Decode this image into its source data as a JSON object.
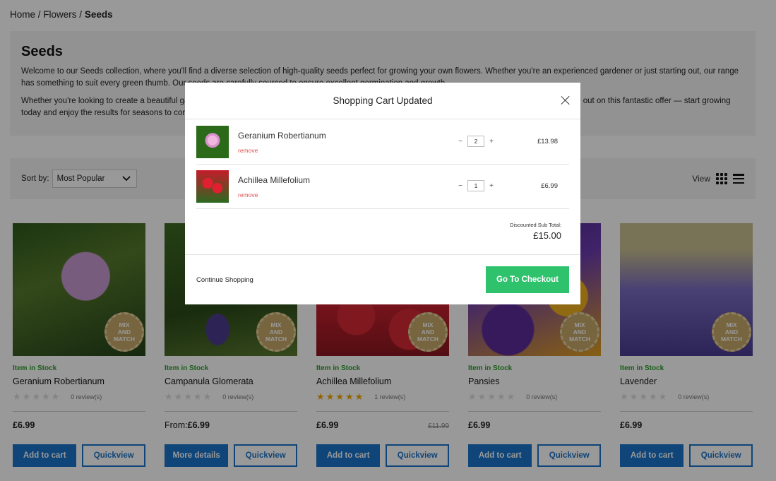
{
  "breadcrumb": {
    "home": "Home",
    "sep": " / ",
    "flowers": "Flowers",
    "current": "Seeds"
  },
  "intro": {
    "title": "Seeds",
    "p1": "Welcome to our Seeds collection, where you'll find a diverse selection of high-quality seeds perfect for growing your own flowers. Whether you're an experienced gardener or just starting out, our range has something to suit every green thumb. Our seeds are carefully sourced to ensure excellent germination and growth.",
    "p2": "Whether you're looking to create a beautiful garden display or fill your borders with vibrant blooms, our seeds collection has everything you need. Don't miss out on this fantastic offer — start growing today and enjoy the results for seasons to come."
  },
  "toolbar": {
    "sort_label": "Sort by:",
    "sort_value": "Most Popular",
    "view_label": "View"
  },
  "products": [
    {
      "name": "Geranium Robertianum",
      "stock": "Item in Stock",
      "reviews": "0 review(s)",
      "price": "£6.99",
      "price_prefix": "",
      "was": "",
      "rating": 0,
      "primary": "Add to cart",
      "secondary": "Quickview"
    },
    {
      "name": "Campanula Glomerata",
      "stock": "Item in Stock",
      "reviews": "0 review(s)",
      "price": "£6.99",
      "price_prefix": "From:",
      "was": "",
      "rating": 0,
      "primary": "More details",
      "secondary": "Quickview"
    },
    {
      "name": "Achillea Millefolium",
      "stock": "Item in Stock",
      "reviews": "1 review(s)",
      "price": "£6.99",
      "price_prefix": "",
      "was": "£11.99",
      "rating": 5,
      "primary": "Add to cart",
      "secondary": "Quickview"
    },
    {
      "name": "Pansies",
      "stock": "Item in Stock",
      "reviews": "0 review(s)",
      "price": "£6.99",
      "price_prefix": "",
      "was": "",
      "rating": 0,
      "primary": "Add to cart",
      "secondary": "Quickview"
    },
    {
      "name": "Lavender",
      "stock": "Item in Stock",
      "reviews": "0 review(s)",
      "price": "£6.99",
      "price_prefix": "",
      "was": "",
      "rating": 0,
      "primary": "Add to cart",
      "secondary": "Quickview"
    }
  ],
  "badge": {
    "line1": "MIX",
    "line2": "AND",
    "line3": "MATCH"
  },
  "modal": {
    "title": "Shopping Cart Updated",
    "items": [
      {
        "name": "Geranium Robertianum",
        "remove": "remove",
        "qty": "2",
        "total": "£13.98"
      },
      {
        "name": "Achillea Millefolium",
        "remove": "remove",
        "qty": "1",
        "total": "£6.99"
      }
    ],
    "qty_minus": "−",
    "qty_plus": "+",
    "subtotal_label": "Discounted Sub Total:",
    "subtotal_value": "£15.00",
    "continue_label": "Continue Shopping",
    "checkout_label": "Go To Checkout"
  },
  "colors": {
    "primary_blue": "#1a73c9",
    "checkout_green": "#2dc26b",
    "stock_green": "#2a9d2a",
    "remove_red": "#e05050",
    "star_gold": "#f0a800"
  },
  "icons": {
    "close": "close-icon",
    "grid_view": "grid-view-icon",
    "list_view": "list-view-icon",
    "sort_dropdown": "chevron-down-icon"
  }
}
